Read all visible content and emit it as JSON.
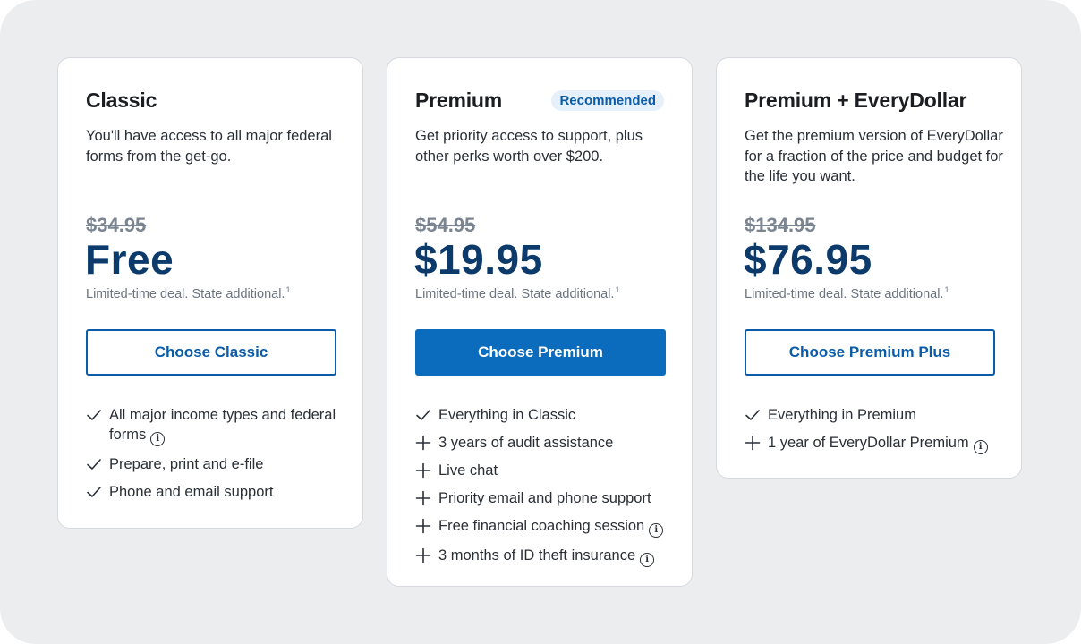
{
  "plans": [
    {
      "title": "Classic",
      "badge": "",
      "description": "You'll have access to all major federal forms from the get-go.",
      "old_price": "$34.95",
      "price": "Free",
      "note": "Limited-time deal. State additional.",
      "note_sup": "1",
      "button": "Choose Classic",
      "features": [
        {
          "icon": "check-icon",
          "text": "All major income types and federal forms",
          "info": true
        },
        {
          "icon": "check-icon",
          "text": "Prepare, print and e-file",
          "info": false
        },
        {
          "icon": "check-icon",
          "text": "Phone and email support",
          "info": false
        }
      ]
    },
    {
      "title": "Premium",
      "badge": "Recommended",
      "description": "Get priority access to support, plus other perks worth over $200.",
      "old_price": "$54.95",
      "price": "$19.95",
      "note": "Limited-time deal. State additional.",
      "note_sup": "1",
      "button": "Choose Premium",
      "features": [
        {
          "icon": "check-icon",
          "text": "Everything in Classic",
          "info": false
        },
        {
          "icon": "plus-icon",
          "text": "3 years of audit assistance",
          "info": false
        },
        {
          "icon": "plus-icon",
          "text": "Live chat",
          "info": false
        },
        {
          "icon": "plus-icon",
          "text": "Priority email and phone support",
          "info": false
        },
        {
          "icon": "plus-icon",
          "text": "Free financial coaching session",
          "info": true
        },
        {
          "icon": "plus-icon",
          "text": "3 months of ID theft insurance",
          "info": true
        }
      ]
    },
    {
      "title": "Premium + EveryDollar",
      "badge": "",
      "description": "Get the premium version of EveryDollar for a fraction of the price and budget for the life you want.",
      "old_price": "$134.95",
      "price": "$76.95",
      "note": "Limited-time deal. State additional.",
      "note_sup": "1",
      "button": "Choose Premium Plus",
      "features": [
        {
          "icon": "check-icon",
          "text": "Everything in Premium",
          "info": false
        },
        {
          "icon": "plus-icon",
          "text": "1 year of EveryDollar Premium",
          "info": true
        }
      ]
    }
  ],
  "colors": {
    "accent": "#0b6cbd",
    "price": "#0c3a6b",
    "background": "#ecedef"
  }
}
